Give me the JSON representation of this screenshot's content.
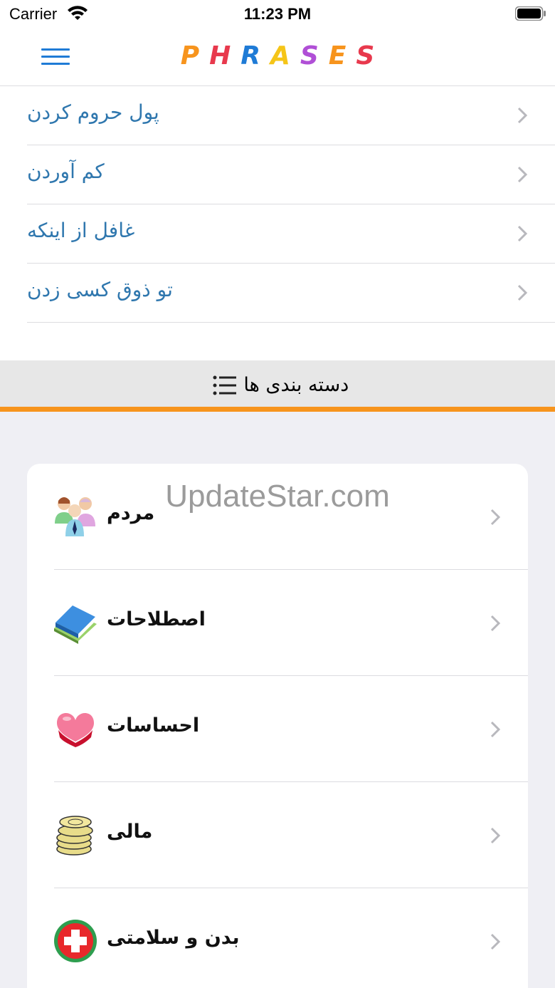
{
  "status_bar": {
    "carrier": "Carrier",
    "time": "11:23 PM"
  },
  "nav": {
    "title_letters": [
      {
        "ch": "P",
        "color": "#f7941d"
      },
      {
        "ch": "H",
        "color": "#e8394d"
      },
      {
        "ch": "R",
        "color": "#1f7bd6"
      },
      {
        "ch": "A",
        "color": "#f5c518"
      },
      {
        "ch": "S",
        "color": "#b04fd6"
      },
      {
        "ch": "E",
        "color": "#f7941d"
      },
      {
        "ch": "S",
        "color": "#e8394d"
      }
    ]
  },
  "phrases": [
    {
      "label": "پول حروم کردن"
    },
    {
      "label": "کم آوردن"
    },
    {
      "label": "غافل از اینکه"
    },
    {
      "label": "تو ذوق کسی زدن"
    }
  ],
  "section": {
    "title": "دسته بندی ها",
    "icon": "list-icon"
  },
  "categories": [
    {
      "label": "مردم",
      "icon": "people-icon"
    },
    {
      "label": "اصطلاحات",
      "icon": "books-icon"
    },
    {
      "label": "احساسات",
      "icon": "heart-box-icon"
    },
    {
      "label": "مالی",
      "icon": "coins-icon"
    },
    {
      "label": "بدن و سلامتی",
      "icon": "health-cross-icon"
    }
  ],
  "watermark": "UpdateStar.com",
  "colors": {
    "accent_orange": "#f7941d",
    "link_blue": "#2f77ae",
    "menu_blue": "#1f7bd6"
  }
}
